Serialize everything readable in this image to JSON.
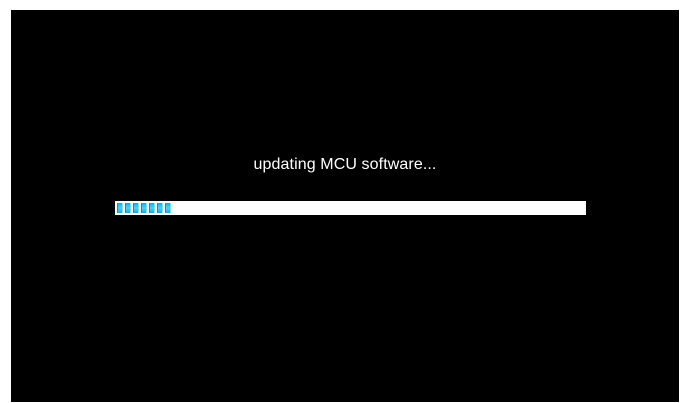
{
  "screen": {
    "status_text": "updating MCU software...",
    "background_color": "#000000",
    "text_color": "#ffffff"
  },
  "progress": {
    "fraction": 0.12,
    "segments_filled": 7,
    "track_color": "#ffffff",
    "fill_color": "#2ec4f0"
  }
}
